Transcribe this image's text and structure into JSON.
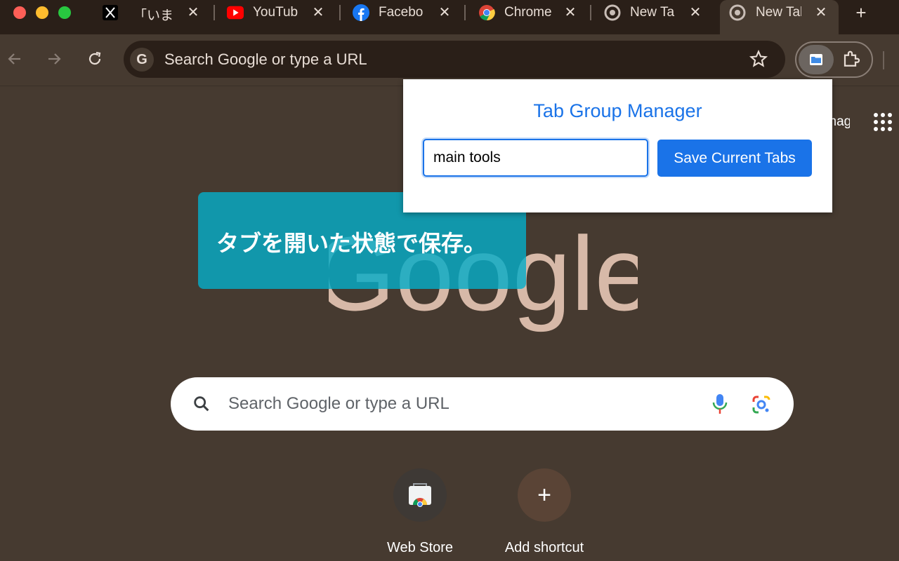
{
  "window": {
    "controls": [
      "close",
      "minimize",
      "maximize"
    ]
  },
  "tabs": [
    {
      "favicon": "x-logo-icon",
      "title": "「いま」"
    },
    {
      "favicon": "youtube-icon",
      "title": "YouTube"
    },
    {
      "favicon": "facebook-icon",
      "title": "Facebook"
    },
    {
      "favicon": "chrome-icon",
      "title": "Chrome"
    },
    {
      "favicon": "chrome-newtab-icon",
      "title": "New Tab"
    },
    {
      "favicon": "chrome-newtab-icon",
      "title": "New Tab",
      "active": true
    }
  ],
  "toolbar": {
    "omnibox_placeholder": "Search Google or type a URL",
    "omnibox_badge": "G"
  },
  "page": {
    "images_link": "Images",
    "logo_text": "Google",
    "search_placeholder": "Search Google or type a URL",
    "shortcuts": [
      {
        "label": "Web Store",
        "icon": "web-store-icon"
      },
      {
        "label": "Add shortcut",
        "icon": "plus-icon",
        "glyph": "+"
      }
    ]
  },
  "popup": {
    "title": "Tab Group Manager",
    "input_value": "main tools",
    "save_button": "Save Current Tabs"
  },
  "caption": {
    "text": "タブを開いた状態で保存。"
  },
  "colors": {
    "page_bg": "#463a30",
    "tabstrip_bg": "#2a1f18",
    "accent_blue": "#1a73e8",
    "caption_bg": "#06acc7",
    "logo_color": "#d7b9a8"
  }
}
